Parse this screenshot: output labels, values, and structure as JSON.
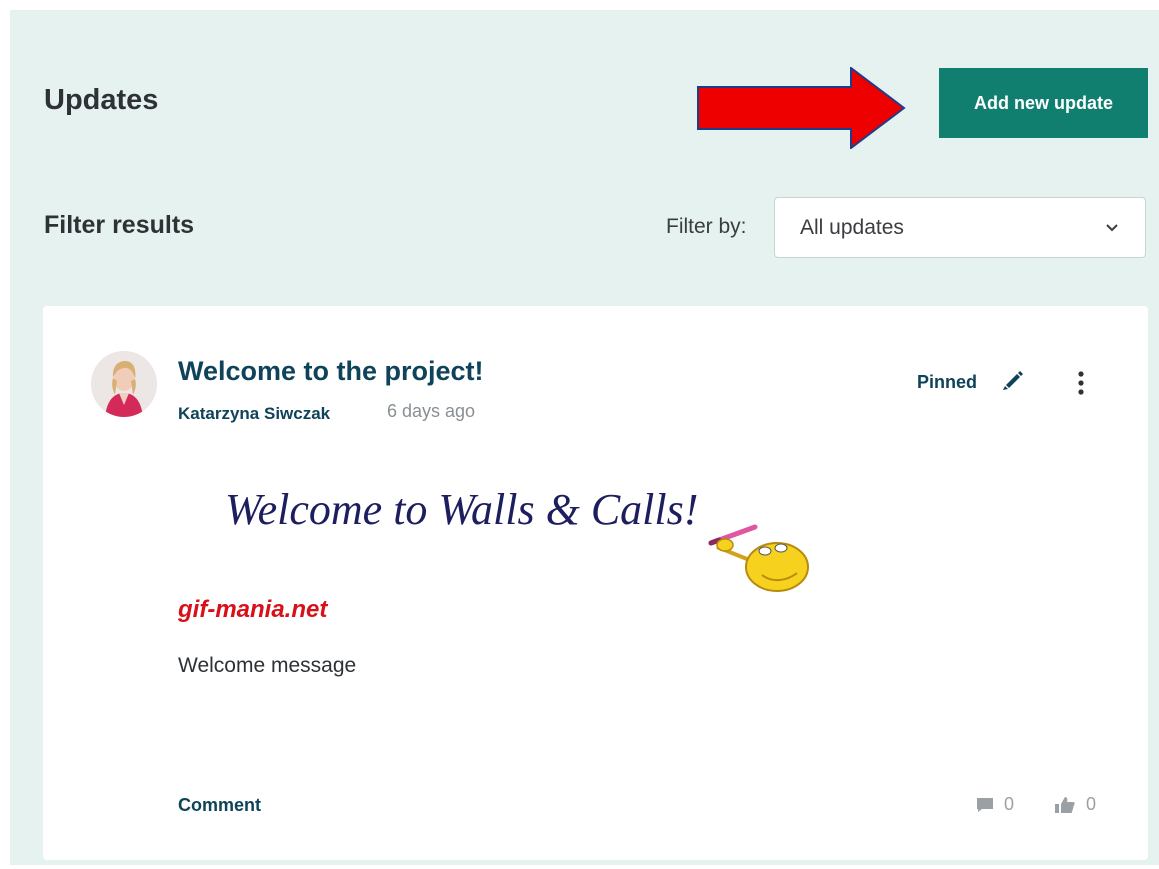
{
  "header": {
    "title": "Updates",
    "add_button_label": "Add new update"
  },
  "filter": {
    "title": "Filter results",
    "label": "Filter by:",
    "selected": "All updates"
  },
  "post": {
    "title": "Welcome to the project!",
    "author": "Katarzyna Siwczak",
    "time_ago": "6 days ago",
    "pinned_label": "Pinned",
    "banner_text": "Welcome to Walls & Calls!",
    "watermark": "gif-mania.net",
    "message": "Welcome message",
    "comment_label": "Comment",
    "comment_count": "0",
    "like_count": "0"
  },
  "colors": {
    "panel_bg": "#e6f2ef",
    "accent": "#117f70",
    "heading": "#0f4359",
    "arrow": "#ee0000"
  },
  "icons": [
    "red-arrow-annotation",
    "chevron-down-icon",
    "pencil-icon",
    "more-vertical-icon",
    "comment-icon",
    "thumbs-up-icon"
  ]
}
